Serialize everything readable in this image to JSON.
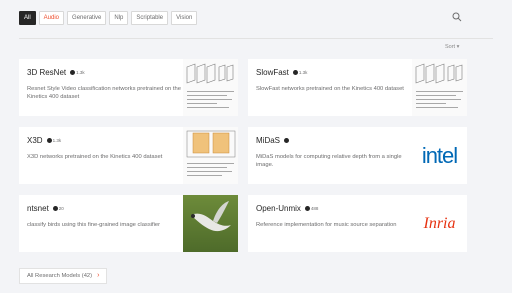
{
  "filters": [
    "All",
    "Audio",
    "Generative",
    "Nlp",
    "Scriptable",
    "Vision"
  ],
  "sort_label": "Sort ▾",
  "models": [
    {
      "name": "3D ResNet",
      "stars": "1.3k",
      "description": "Resnet Style Video classification networks pretrained on the Kinetics 400 dataset"
    },
    {
      "name": "SlowFast",
      "stars": "1.3k",
      "description": "SlowFast networks pretrained on the Kinetics 400 dataset"
    },
    {
      "name": "X3D",
      "stars": "1.3k",
      "description": "X3D networks pretrained on the Kinetics 400 dataset"
    },
    {
      "name": "MiDaS",
      "stars": "",
      "description": "MiDaS models for computing relative depth from a single image."
    },
    {
      "name": "ntsnet",
      "stars": "20",
      "description": "classify birds using this fine-grained image classifier"
    },
    {
      "name": "Open-Unmix",
      "stars": "488",
      "description": "Reference implementation for music source separation"
    }
  ],
  "logos": {
    "intel": "intel",
    "inria": "Inria"
  },
  "all_models_label": "All Research Models (42)",
  "colors": {
    "accent": "#ee4c2c",
    "intel_blue": "#0068b5",
    "inria_red": "#e63312"
  }
}
